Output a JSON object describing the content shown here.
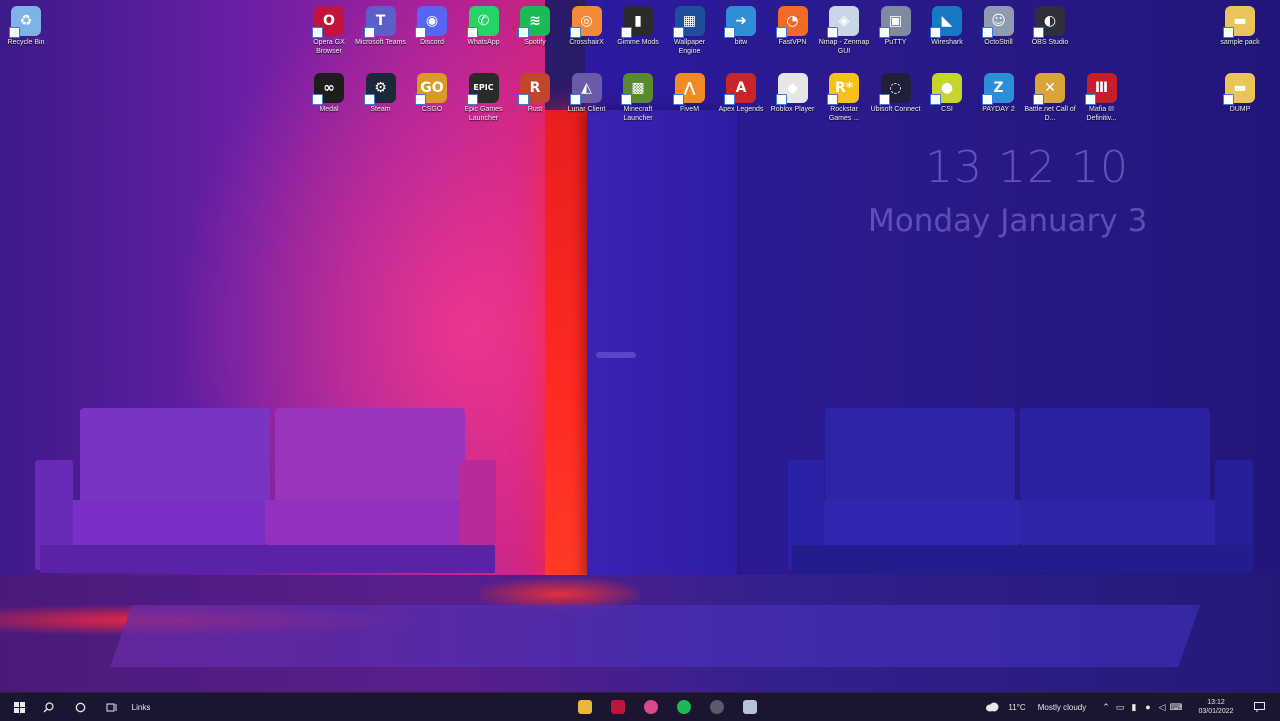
{
  "desktop": {
    "left_icons": [
      {
        "id": "recycle-bin",
        "label": "Recycle Bin",
        "color": "#7fb3e6",
        "glyph": "♻"
      }
    ],
    "top_row_1": [
      {
        "id": "opera-gx",
        "label": "Opera GX Browser",
        "color": "#c0143c",
        "glyph": "O"
      },
      {
        "id": "microsoft-teams",
        "label": "Microsoft Teams",
        "color": "#5b5fc7",
        "glyph": "T"
      },
      {
        "id": "discord",
        "label": "Discord",
        "color": "#5865f2",
        "glyph": "◉"
      },
      {
        "id": "whatsapp",
        "label": "WhatsApp",
        "color": "#25d366",
        "glyph": "✆"
      },
      {
        "id": "spotify",
        "label": "Spotify",
        "color": "#1db954",
        "glyph": "≋"
      },
      {
        "id": "crosshairx",
        "label": "CrosshairX",
        "color": "#f28a3a",
        "glyph": "◎"
      },
      {
        "id": "gimme-mods",
        "label": "Gimme Mods",
        "color": "#2b2b2b",
        "glyph": "▮"
      },
      {
        "id": "wallpaper-engine",
        "label": "Wallpaper Engine",
        "color": "#1e4f9a",
        "glyph": "▦"
      },
      {
        "id": "bitw",
        "label": "bitw",
        "color": "#2f8fd6",
        "glyph": "➜"
      },
      {
        "id": "fastvpn",
        "label": "FastVPN",
        "color": "#f06a28",
        "glyph": "◔"
      },
      {
        "id": "nmap",
        "label": "Nmap - Zenmap GUI",
        "color": "#c9d6e6",
        "glyph": "◈"
      },
      {
        "id": "putty",
        "label": "PuTTY",
        "color": "#7d8aa0",
        "glyph": "▣"
      },
      {
        "id": "wireshark",
        "label": "Wireshark",
        "color": "#1679c5",
        "glyph": "◣"
      },
      {
        "id": "ghostwriter",
        "label": "OctoStrill",
        "color": "#8e9bb0",
        "glyph": "☺"
      },
      {
        "id": "obs-studio",
        "label": "OBS Studio",
        "color": "#302e3a",
        "glyph": "◐"
      }
    ],
    "top_row_2": [
      {
        "id": "medal",
        "label": "Medal",
        "color": "#1d1d1d",
        "glyph": "∞"
      },
      {
        "id": "steam",
        "label": "Steam",
        "color": "#1b2838",
        "glyph": "⚙"
      },
      {
        "id": "csgo",
        "label": "CSGO",
        "color": "#d99a2b",
        "glyph": "GO"
      },
      {
        "id": "epic-games",
        "label": "Epic Games Launcher",
        "color": "#2a2a2a",
        "glyph": "EPIC"
      },
      {
        "id": "rust",
        "label": "Rust",
        "color": "#c2452d",
        "glyph": "R"
      },
      {
        "id": "lunar-client",
        "label": "Lunar Client",
        "color": "#6a5aa8",
        "glyph": "◭"
      },
      {
        "id": "minecraft",
        "label": "Minecraft Launcher",
        "color": "#5a8a2e",
        "glyph": "▩"
      },
      {
        "id": "fivem",
        "label": "FiveM",
        "color": "#f08a24",
        "glyph": "⋀"
      },
      {
        "id": "apex-legends",
        "label": "Apex Legends",
        "color": "#c9262a",
        "glyph": "A"
      },
      {
        "id": "roblox",
        "label": "Roblox Player",
        "color": "#e6e6e6",
        "glyph": "◆"
      },
      {
        "id": "rockstar",
        "label": "Rockstar Games ...",
        "color": "#f5c21a",
        "glyph": "R*"
      },
      {
        "id": "ubisoft",
        "label": "Ubisoft Connect",
        "color": "#1f1f3a",
        "glyph": "◌"
      },
      {
        "id": "csi",
        "label": "CSI",
        "color": "#c6d62a",
        "glyph": "●"
      },
      {
        "id": "paladins",
        "label": "PAYDAY 2",
        "color": "#2a8fd8",
        "glyph": "Z"
      },
      {
        "id": "call-of-duty",
        "label": "Battle.net Call of D...",
        "color": "#d9a43a",
        "glyph": "✕"
      },
      {
        "id": "mafia",
        "label": "Mafia III Definitiv...",
        "color": "#c61e2a",
        "glyph": "Ⅲ"
      }
    ],
    "right_icons": [
      {
        "id": "sample-pack",
        "label": "sample pack",
        "color": "#e8c45a",
        "glyph": "▬"
      },
      {
        "id": "dump",
        "label": "DUMP",
        "color": "#e8c45a",
        "glyph": "▬"
      }
    ]
  },
  "clock_widget": {
    "time": "13 12 10",
    "date": "Monday January 3"
  },
  "taskbar": {
    "start_icon": "windows-icon",
    "search_icon": "search-icon",
    "cortana_icon": "cortana-icon",
    "taskview_icon": "task-view-icon",
    "links_label": "Links",
    "pinned": [
      {
        "id": "file-explorer",
        "color": "#e8b93a"
      },
      {
        "id": "opera-gx",
        "color": "#c0143c"
      },
      {
        "id": "chrome-like",
        "color": "#d84a8a"
      },
      {
        "id": "spotify",
        "color": "#1db954"
      },
      {
        "id": "obs",
        "color": "#5a5a6a"
      },
      {
        "id": "app-generic",
        "color": "#b6c2d6"
      }
    ],
    "weather_temp": "11°C",
    "weather_text": "Mostly cloudy",
    "clock_time": "13:12",
    "clock_date": "03/01/2022"
  }
}
